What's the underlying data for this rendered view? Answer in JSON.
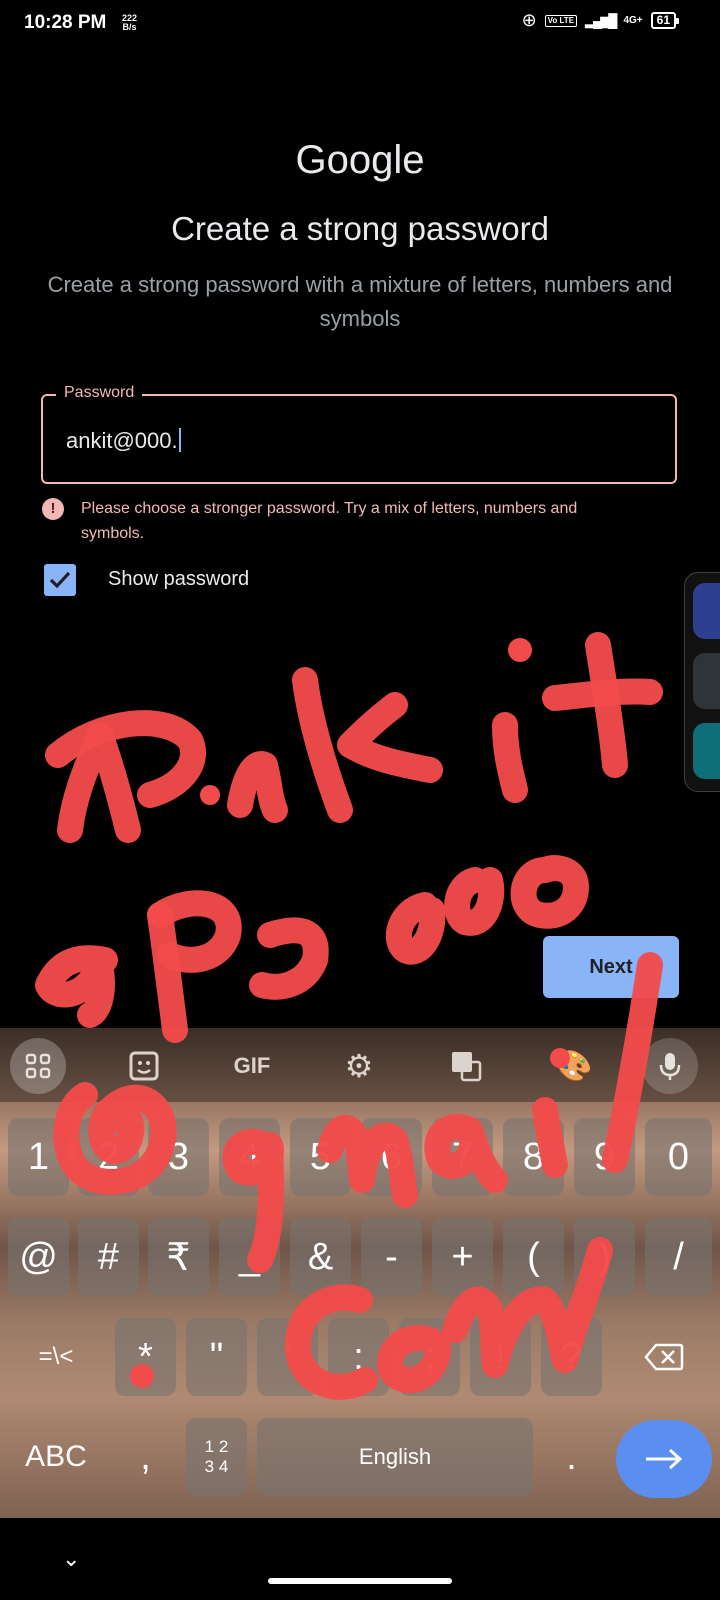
{
  "status_bar": {
    "time": "10:28 PM",
    "speed_value": "222",
    "speed_unit": "B/s",
    "volte": "Vo LTE",
    "network": "4G+",
    "battery": "61"
  },
  "page": {
    "logo_text": "Google",
    "title": "Create a strong password",
    "subtitle": "Create a strong password with a mixture of letters, numbers and symbols"
  },
  "password_field": {
    "label": "Password",
    "value": "ankit@000."
  },
  "error": {
    "icon": "!",
    "message": "Please choose a stronger password. Try a mix of letters, numbers and symbols."
  },
  "show_password": {
    "label": "Show password",
    "checked": true
  },
  "next_button": {
    "label": "Next"
  },
  "keyboard": {
    "toolbar": [
      "apps",
      "sticker",
      "GIF",
      "settings",
      "translate",
      "theme",
      "microphone"
    ],
    "gif_label": "GIF",
    "row1": [
      "1",
      "2",
      "3",
      "4",
      "5",
      "6",
      "7",
      "8",
      "9",
      "0"
    ],
    "row2": [
      "@",
      "#",
      "₹",
      "_",
      "&",
      "-",
      "+",
      "(",
      ")",
      "/"
    ],
    "row3": [
      "=\\<",
      "*",
      "\"",
      "'",
      ":",
      ";",
      "!",
      "?"
    ],
    "row4": {
      "abc": "ABC",
      "comma": ",",
      "numpad": "1 2\n3 4",
      "space": "English",
      "period": "."
    }
  },
  "colors": {
    "accent_blue": "#8ab4f8",
    "error_pink": "#f2b8b5",
    "scribble_red": "#f24b4b"
  }
}
